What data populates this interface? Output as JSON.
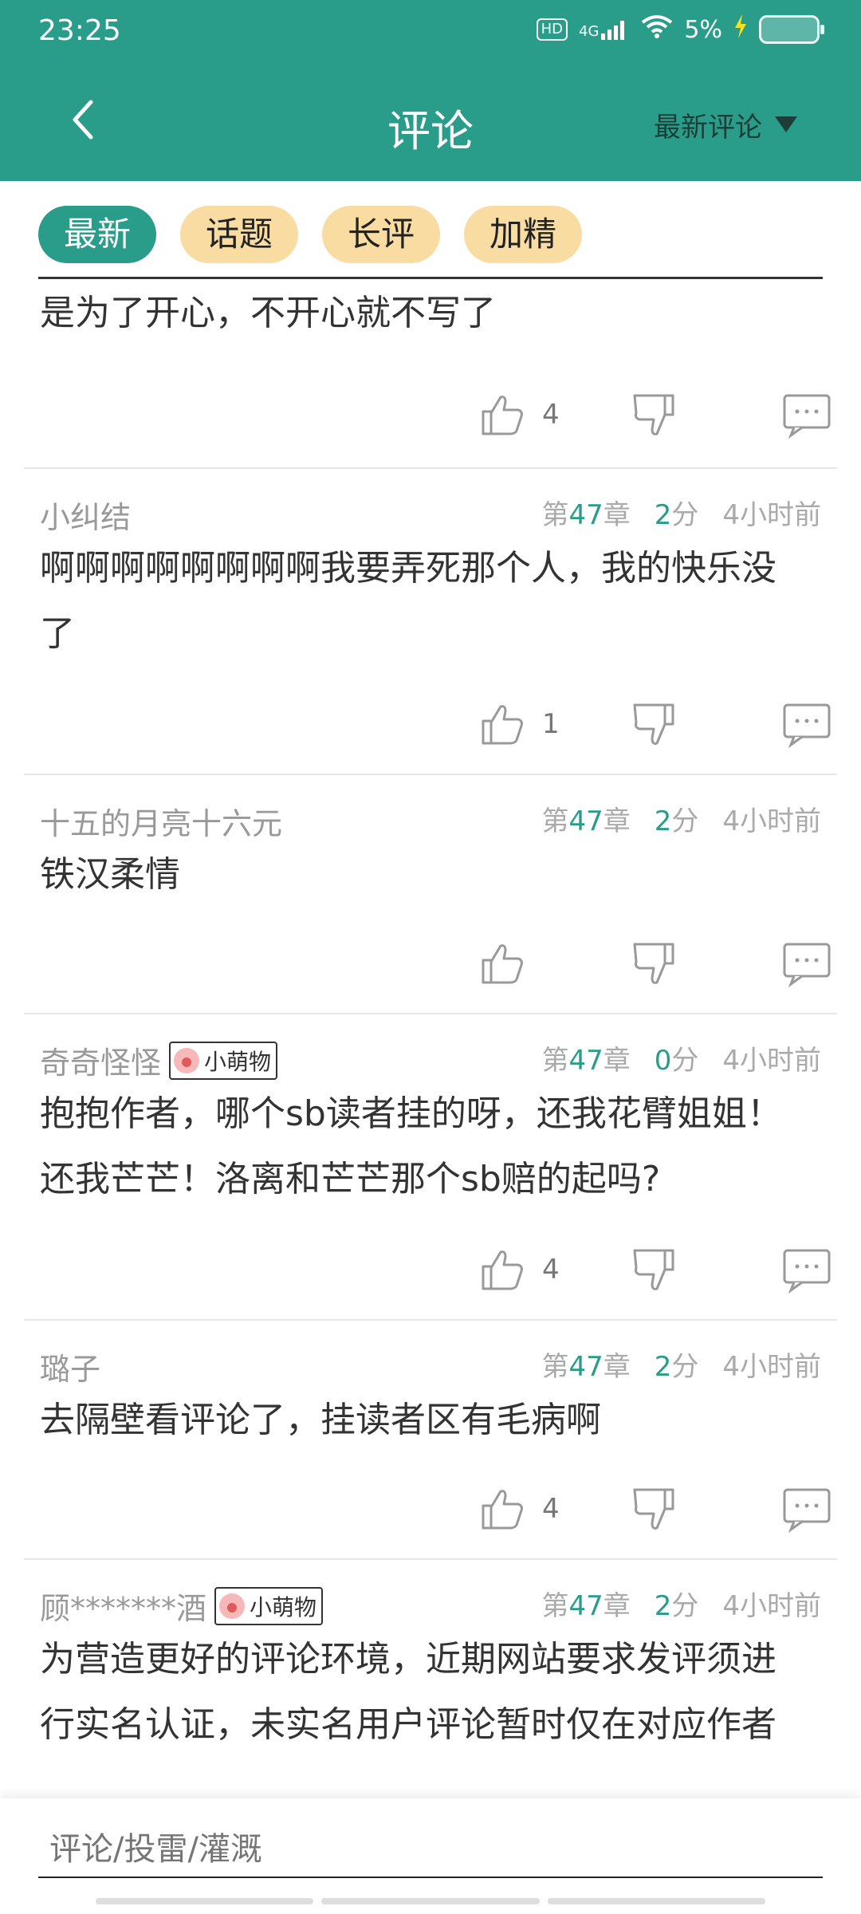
{
  "status": {
    "time": "23:25",
    "hd": "HD",
    "network": "4G",
    "battery": "5%"
  },
  "header": {
    "title": "评论",
    "sort_label": "最新评论"
  },
  "tabs": [
    {
      "label": "最新",
      "active": true
    },
    {
      "label": "话题",
      "active": false
    },
    {
      "label": "长评",
      "active": false
    },
    {
      "label": "加精",
      "active": false
    }
  ],
  "comments": [
    {
      "user": "",
      "badge": "",
      "chapter_prefix": "",
      "chapter_num": "",
      "chapter_suffix": "",
      "score_num": "",
      "score_unit": "",
      "time": "",
      "text": "是为了开心，不开心就不写了",
      "likes": "4"
    },
    {
      "user": "小纠结",
      "badge": "",
      "chapter_prefix": "第",
      "chapter_num": "47",
      "chapter_suffix": "章",
      "score_num": "2",
      "score_unit": "分",
      "time": "4小时前",
      "text": "啊啊啊啊啊啊啊啊我要弄死那个人，我的快乐没了",
      "likes": "1"
    },
    {
      "user": "十五的月亮十六元",
      "badge": "",
      "chapter_prefix": "第",
      "chapter_num": "47",
      "chapter_suffix": "章",
      "score_num": "2",
      "score_unit": "分",
      "time": "4小时前",
      "text": "铁汉柔情",
      "likes": ""
    },
    {
      "user": "奇奇怪怪",
      "badge": "小萌物",
      "chapter_prefix": "第",
      "chapter_num": "47",
      "chapter_suffix": "章",
      "score_num": "0",
      "score_unit": "分",
      "time": "4小时前",
      "text": "抱抱作者，哪个sb读者挂的呀，还我花臂姐姐！还我芒芒！洛离和芒芒那个sb赔的起吗?",
      "likes": "4"
    },
    {
      "user": "璐子",
      "badge": "",
      "chapter_prefix": "第",
      "chapter_num": "47",
      "chapter_suffix": "章",
      "score_num": "2",
      "score_unit": "分",
      "time": "4小时前",
      "text": "去隔壁看评论了，挂读者区有毛病啊",
      "likes": "4"
    },
    {
      "user": "顾*******酒",
      "badge": "小萌物",
      "chapter_prefix": "第",
      "chapter_num": "47",
      "chapter_suffix": "章",
      "score_num": "2",
      "score_unit": "分",
      "time": "4小时前",
      "text": "为营造更好的评论环境，近期网站要求发评须进行实名认证，未实名用户评论暂时仅在对应作者",
      "likes": ""
    }
  ],
  "input": {
    "placeholder": "评论/投雷/灌溉"
  }
}
